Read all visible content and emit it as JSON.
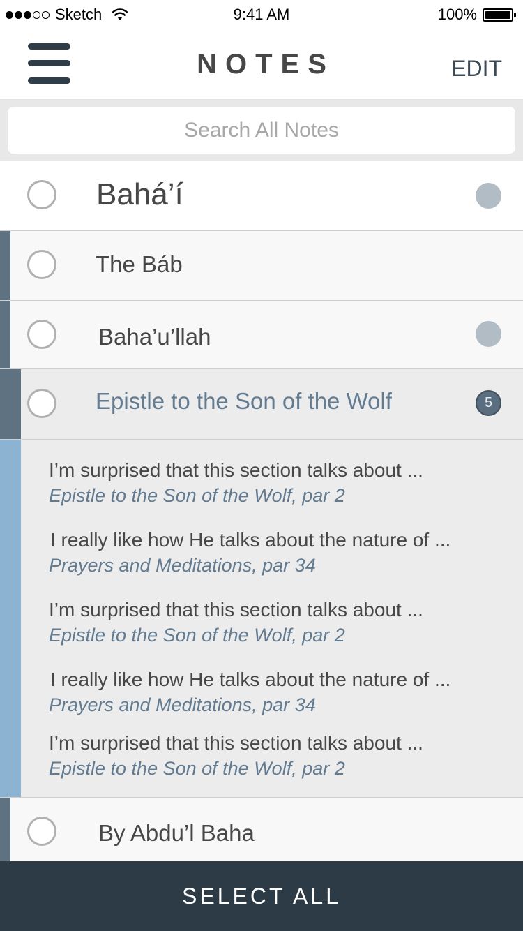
{
  "status_bar": {
    "carrier": "Sketch",
    "time": "9:41 AM",
    "battery": "100%"
  },
  "header": {
    "title": "NOTES",
    "edit_label": "EDIT",
    "menu_icon": "hamburger-menu-icon"
  },
  "search": {
    "placeholder": "Search All Notes",
    "value": ""
  },
  "list": {
    "items": [
      {
        "label": "Bahá’í",
        "indicator": "dot"
      },
      {
        "label": "The Báb"
      },
      {
        "label": "Baha’u’llah",
        "indicator": "dot"
      },
      {
        "label": "Epistle to the Son of the Wolf",
        "count": "5",
        "expanded": true
      },
      {
        "label": "By Abdu’l Baha"
      }
    ]
  },
  "notes": [
    {
      "text": "I’m surprised that this section talks about ...",
      "source": "Epistle to the Son of the Wolf, par 2"
    },
    {
      "text": "I really like how He talks about the nature of ...",
      "source": "Prayers and Meditations, par 34"
    },
    {
      "text": "I’m surprised that this section talks about ...",
      "source": "Epistle to the Son of the Wolf, par 2"
    },
    {
      "text": "I really like how He talks about the nature of ...",
      "source": "Prayers and Meditations, par 34"
    },
    {
      "text": "I’m surprised that this section talks about ...",
      "source": "Epistle to the Son of the Wolf, par 2"
    }
  ],
  "footer": {
    "select_all_label": "SELECT ALL"
  },
  "colors": {
    "dark_navy": "#2c3b46",
    "accent_slate": "#5e7281",
    "accent_light_blue": "#8db3d2",
    "highlight_text": "#627b91",
    "indicator_gray": "#b2bcc4",
    "badge_fill": "#5a6e7f"
  }
}
